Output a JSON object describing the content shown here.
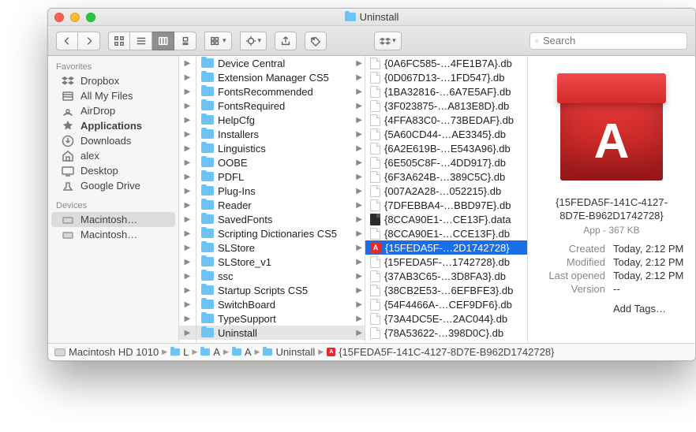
{
  "window": {
    "title": "Uninstall"
  },
  "search": {
    "placeholder": "Search"
  },
  "sidebar": {
    "favorites_label": "Favorites",
    "devices_label": "Devices",
    "favorites": [
      {
        "label": "Dropbox",
        "icon": "dropbox"
      },
      {
        "label": "All My Files",
        "icon": "allfiles"
      },
      {
        "label": "AirDrop",
        "icon": "airdrop"
      },
      {
        "label": "Applications",
        "icon": "apps",
        "bold": true
      },
      {
        "label": "Downloads",
        "icon": "downloads"
      },
      {
        "label": "alex",
        "icon": "home"
      },
      {
        "label": "Desktop",
        "icon": "desktop"
      },
      {
        "label": "Google Drive",
        "icon": "gdrive"
      }
    ],
    "devices": [
      {
        "label": "Macintosh…",
        "icon": "hd",
        "selected": true
      },
      {
        "label": "Macintosh…",
        "icon": "hd"
      }
    ]
  },
  "col1": [
    {
      "label": "Device Central",
      "type": "folder"
    },
    {
      "label": "Extension Manager CS5",
      "type": "folder"
    },
    {
      "label": "FontsRecommended",
      "type": "folder"
    },
    {
      "label": "FontsRequired",
      "type": "folder"
    },
    {
      "label": "HelpCfg",
      "type": "folder"
    },
    {
      "label": "Installers",
      "type": "folder"
    },
    {
      "label": "Linguistics",
      "type": "folder"
    },
    {
      "label": "OOBE",
      "type": "folder"
    },
    {
      "label": "PDFL",
      "type": "folder"
    },
    {
      "label": "Plug-Ins",
      "type": "folder"
    },
    {
      "label": "Reader",
      "type": "folder"
    },
    {
      "label": "SavedFonts",
      "type": "folder"
    },
    {
      "label": "Scripting Dictionaries CS5",
      "type": "folder"
    },
    {
      "label": "SLStore",
      "type": "folder"
    },
    {
      "label": "SLStore_v1",
      "type": "folder"
    },
    {
      "label": "ssc",
      "type": "folder"
    },
    {
      "label": "Startup Scripts CS5",
      "type": "folder"
    },
    {
      "label": "SwitchBoard",
      "type": "folder"
    },
    {
      "label": "TypeSupport",
      "type": "folder"
    },
    {
      "label": "Uninstall",
      "type": "folder",
      "selected": true
    }
  ],
  "col2": [
    {
      "label": "{0A6FC585-…4FE1B7A}.db",
      "type": "doc"
    },
    {
      "label": "{0D067D13-…1FD547}.db",
      "type": "doc"
    },
    {
      "label": "{1BA32816-…6A7E5AF}.db",
      "type": "doc"
    },
    {
      "label": "{3F023875-…A813E8D}.db",
      "type": "doc"
    },
    {
      "label": "{4FFA83C0-…73BEDAF}.db",
      "type": "doc"
    },
    {
      "label": "{5A60CD44-…AE3345}.db",
      "type": "doc"
    },
    {
      "label": "{6A2E619B-…E543A96}.db",
      "type": "doc"
    },
    {
      "label": "{6E505C8F-…4DD917}.db",
      "type": "doc"
    },
    {
      "label": "{6F3A624B-…389C5C}.db",
      "type": "doc"
    },
    {
      "label": "{007A2A28-…052215}.db",
      "type": "doc"
    },
    {
      "label": "{7DFEBBA4-…BBD97E}.db",
      "type": "doc"
    },
    {
      "label": "{8CCA90E1-…CE13F}.data",
      "type": "dark"
    },
    {
      "label": "{8CCA90E1-…CCE13F}.db",
      "type": "doc"
    },
    {
      "label": "{15FEDA5F-…2D1742728}",
      "type": "app",
      "selected": true
    },
    {
      "label": "{15FEDA5F-…1742728}.db",
      "type": "doc"
    },
    {
      "label": "{37AB3C65-…3D8FA3}.db",
      "type": "doc"
    },
    {
      "label": "{38CB2E53-…6EFBFE3}.db",
      "type": "doc"
    },
    {
      "label": "{54F4466A-…CEF9DF6}.db",
      "type": "doc"
    },
    {
      "label": "{73A4DC5E-…2AC044}.db",
      "type": "doc"
    },
    {
      "label": "{78A53622-…398D0C}.db",
      "type": "doc"
    }
  ],
  "preview": {
    "name_l1": "{15FEDA5F-141C-4127-",
    "name_l2": "8D7E-B962D1742728}",
    "kind": "App - 367 KB",
    "rows": [
      {
        "k": "Created",
        "v": "Today, 2:12 PM"
      },
      {
        "k": "Modified",
        "v": "Today, 2:12 PM"
      },
      {
        "k": "Last opened",
        "v": "Today, 2:12 PM"
      },
      {
        "k": "Version",
        "v": "--"
      }
    ],
    "add_tags": "Add Tags…"
  },
  "pathbar": [
    {
      "label": "Macintosh HD 1010",
      "icon": "hd"
    },
    {
      "label": "L",
      "icon": "folder"
    },
    {
      "label": "A",
      "icon": "folder"
    },
    {
      "label": "A",
      "icon": "folder"
    },
    {
      "label": "Uninstall",
      "icon": "folder"
    },
    {
      "label": "{15FEDA5F-141C-4127-8D7E-B962D1742728}",
      "icon": "app"
    }
  ]
}
